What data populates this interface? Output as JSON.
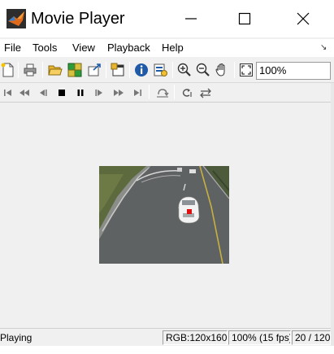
{
  "window": {
    "title": "Movie Player",
    "icon": "matlab-logo-icon"
  },
  "menu": {
    "items": [
      "File",
      "Tools",
      "View",
      "Playback",
      "Help"
    ],
    "overflow_icon": "dock-arrow-icon"
  },
  "toolbar": {
    "zoom_value": "100%",
    "icons": [
      "new-file-icon",
      "print-icon",
      "open-folder-icon",
      "connect-icon",
      "export-icon",
      "new-window-icon",
      "info-icon",
      "properties-icon",
      "zoom-in-icon",
      "zoom-out-icon",
      "pan-hand-icon",
      "fit-to-window-icon"
    ]
  },
  "playback_controls": {
    "icons": [
      "go-to-first-icon",
      "rewind-icon",
      "step-back-icon",
      "stop-icon",
      "pause-icon",
      "step-forward-icon",
      "fast-forward-icon",
      "go-to-last-icon",
      "jump-to-icon",
      "loop-icon",
      "playback-direction-icon"
    ]
  },
  "status": {
    "state": "Playing",
    "color_format": "RGB:120x160",
    "rate": "100% (15 fps)",
    "frame": "20 / 120"
  },
  "colors": {
    "chrome": "#f0f0f0",
    "title_bar": "#ffffff",
    "info_blue": "#1e5aa8",
    "stop_black": "#000000",
    "tracked_marker": "#e01010"
  }
}
